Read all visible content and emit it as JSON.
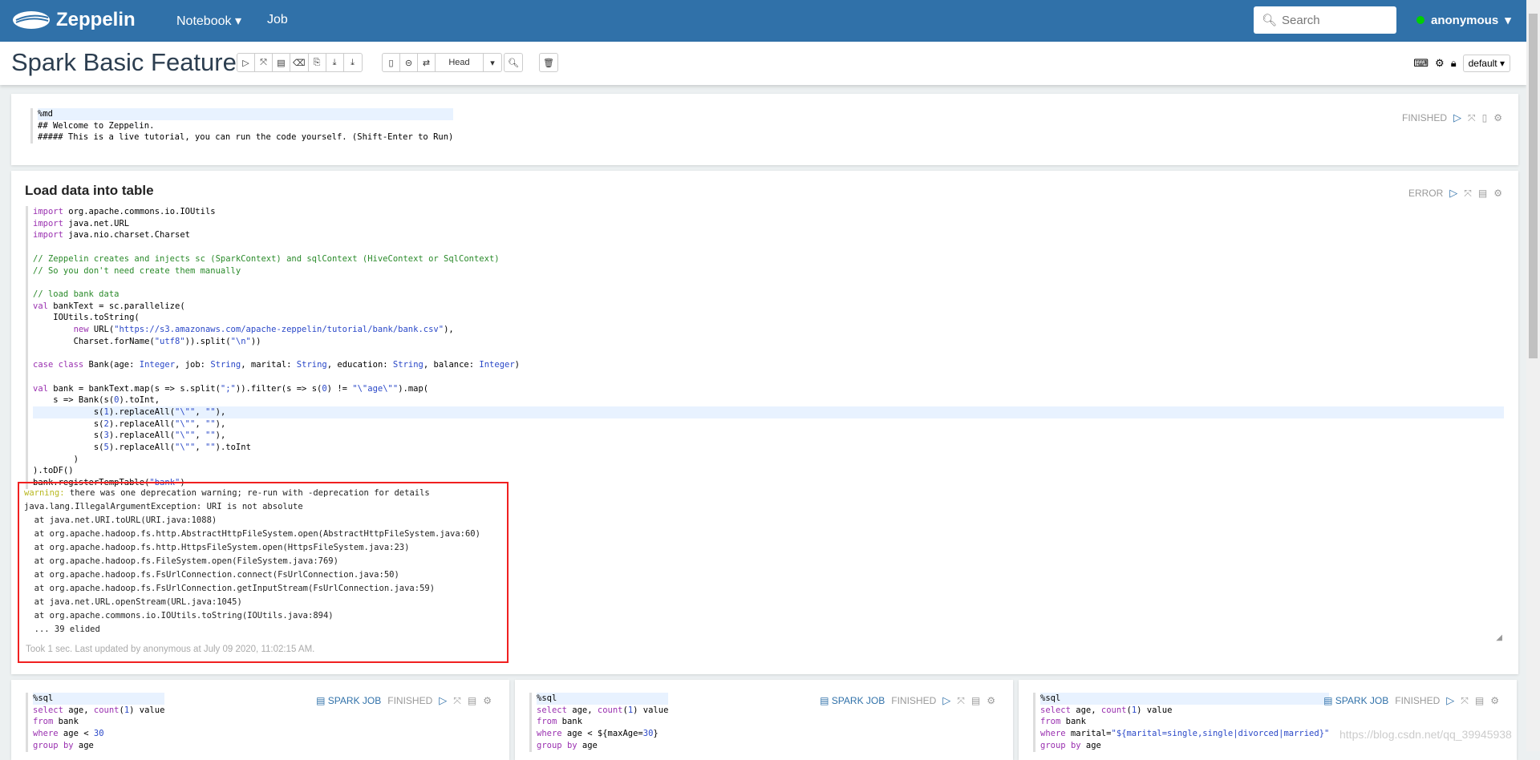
{
  "nav": {
    "brand": "Zeppelin",
    "notebook": "Notebook",
    "job": "Job",
    "search_placeholder": "Search",
    "user": "anonymous"
  },
  "header": {
    "title": "Spark Basic Features",
    "head_label": "Head",
    "interpreter": "default"
  },
  "paragraphs": [
    {
      "status": "FINISHED",
      "code": [
        "%md",
        "## Welcome to Zeppelin.",
        "##### This is a live tutorial, you can run the code yourself. (Shift-Enter to Run)"
      ]
    },
    {
      "title": "Load data into table",
      "status": "ERROR",
      "code": [
        "import org.apache.commons.io.IOUtils",
        "import java.net.URL",
        "import java.nio.charset.Charset",
        "",
        "// Zeppelin creates and injects sc (SparkContext) and sqlContext (HiveContext or SqlContext)",
        "// So you don't need create them manually",
        "",
        "// load bank data",
        "val bankText = sc.parallelize(",
        "    IOUtils.toString(",
        "        new URL(\"https://s3.amazonaws.com/apache-zeppelin/tutorial/bank/bank.csv\"),",
        "        Charset.forName(\"utf8\")).split(\"\\n\"))",
        "",
        "case class Bank(age: Integer, job: String, marital: String, education: String, balance: Integer)",
        "",
        "val bank = bankText.map(s => s.split(\";\")).filter(s => s(0) != \"\\\"age\\\"\").map(",
        "    s => Bank(s(0).toInt,",
        "            s(1).replaceAll(\"\\\"\", \"\"),",
        "            s(2).replaceAll(\"\\\"\", \"\"),",
        "            s(3).replaceAll(\"\\\"\", \"\"),",
        "            s(5).replaceAll(\"\\\"\", \"\").toInt",
        "        )",
        ").toDF()",
        "bank.registerTempTable(\"bank\")"
      ],
      "output": {
        "warning_label": "warning:",
        "warning_text": " there was one deprecation warning; re-run with -deprecation for details",
        "lines": [
          "java.lang.IllegalArgumentException: URI is not absolute",
          "  at java.net.URI.toURL(URI.java:1088)",
          "  at org.apache.hadoop.fs.http.AbstractHttpFileSystem.open(AbstractHttpFileSystem.java:60)",
          "  at org.apache.hadoop.fs.http.HttpsFileSystem.open(HttpsFileSystem.java:23)",
          "  at org.apache.hadoop.fs.FileSystem.open(FileSystem.java:769)",
          "  at org.apache.hadoop.fs.FsUrlConnection.connect(FsUrlConnection.java:50)",
          "  at org.apache.hadoop.fs.FsUrlConnection.getInputStream(FsUrlConnection.java:59)",
          "  at java.net.URL.openStream(URL.java:1045)",
          "  at org.apache.commons.io.IOUtils.toString(IOUtils.java:894)",
          "  ... 39 elided"
        ]
      },
      "footer": "Took 1 sec. Last updated by anonymous at July 09 2020, 11:02:15 AM."
    },
    {
      "status": "FINISHED",
      "spark_job": "SPARK JOB",
      "code": [
        "%sql",
        "select age, count(1) value",
        "from bank",
        "where age < 30",
        "group by age"
      ]
    },
    {
      "status": "FINISHED",
      "spark_job": "SPARK JOB",
      "code": [
        "%sql",
        "select age, count(1) value",
        "from bank",
        "where age < ${maxAge=30}",
        "group by age"
      ]
    },
    {
      "status": "FINISHED",
      "spark_job": "SPARK JOB",
      "code": [
        "%sql",
        "select age, count(1) value",
        "from bank",
        "where marital=\"${marital=single,single|divorced|married}\"",
        "group by age"
      ]
    }
  ],
  "watermark": "https://blog.csdn.net/qq_39945938",
  "colors": {
    "navbar": "#3071a9",
    "error_border": "#f02020",
    "keyword": "#9a30b0",
    "string": "#2a48c8",
    "comment": "#2a8a2a"
  }
}
